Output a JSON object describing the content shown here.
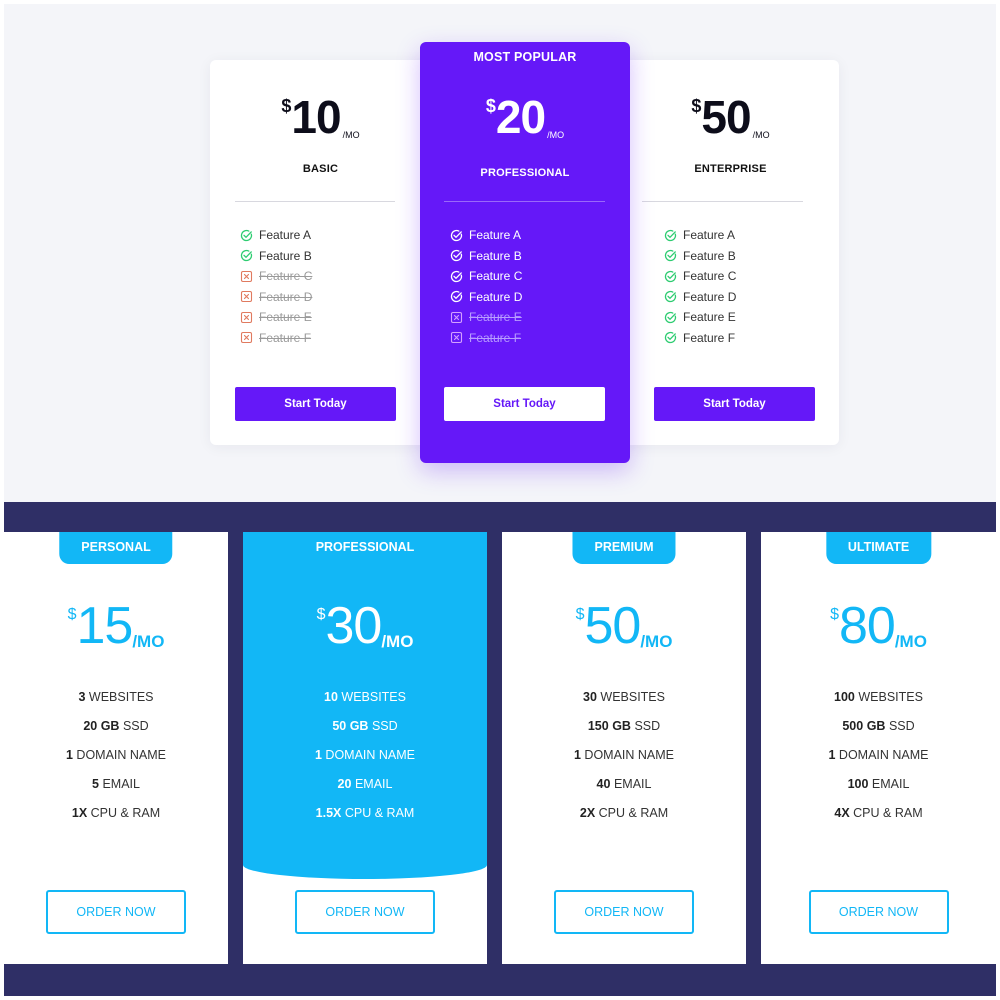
{
  "colors": {
    "purple_accent": "#6518f8",
    "sky_accent": "#12b7f6",
    "navy_band": "#2f2f66",
    "check_green": "#2ecc71",
    "cross_red": "#e07a5f"
  },
  "top_plans": [
    {
      "currency": "$",
      "amount": "10",
      "per": "/MO",
      "name": "BASIC",
      "features": [
        {
          "label": "Feature A",
          "included": true
        },
        {
          "label": "Feature B",
          "included": true
        },
        {
          "label": "Feature C",
          "included": false
        },
        {
          "label": "Feature D",
          "included": false
        },
        {
          "label": "Feature E",
          "included": false
        },
        {
          "label": "Feature F",
          "included": false
        }
      ],
      "button": "Start Today"
    },
    {
      "ribbon": "MOST POPULAR",
      "currency": "$",
      "amount": "20",
      "per": "/MO",
      "name": "PROFESSIONAL",
      "features": [
        {
          "label": "Feature A",
          "included": true
        },
        {
          "label": "Feature B",
          "included": true
        },
        {
          "label": "Feature C",
          "included": true
        },
        {
          "label": "Feature D",
          "included": true
        },
        {
          "label": "Feature E",
          "included": false
        },
        {
          "label": "Feature F",
          "included": false
        }
      ],
      "button": "Start Today"
    },
    {
      "currency": "$",
      "amount": "50",
      "per": "/MO",
      "name": "ENTERPRISE",
      "features": [
        {
          "label": "Feature A",
          "included": true
        },
        {
          "label": "Feature B",
          "included": true
        },
        {
          "label": "Feature C",
          "included": true
        },
        {
          "label": "Feature D",
          "included": true
        },
        {
          "label": "Feature E",
          "included": true
        },
        {
          "label": "Feature F",
          "included": true
        }
      ],
      "button": "Start Today"
    }
  ],
  "bottom_plans": [
    {
      "tag": "PERSONAL",
      "currency": "$",
      "amount": "15",
      "per": "/MO",
      "specs": [
        {
          "value": "3",
          "text": "WEBSITES"
        },
        {
          "value": "20 GB",
          "text": "SSD"
        },
        {
          "value": "1",
          "text": "DOMAIN NAME"
        },
        {
          "value": "5",
          "text": "EMAIL"
        },
        {
          "value": "1X",
          "text": "CPU & RAM"
        }
      ],
      "button": "ORDER NOW"
    },
    {
      "tag": "PROFESSIONAL",
      "currency": "$",
      "amount": "30",
      "per": "/MO",
      "specs": [
        {
          "value": "10",
          "text": "WEBSITES"
        },
        {
          "value": "50 GB",
          "text": "SSD"
        },
        {
          "value": "1",
          "text": "DOMAIN NAME"
        },
        {
          "value": "20",
          "text": "EMAIL"
        },
        {
          "value": "1.5X",
          "text": "CPU & RAM"
        }
      ],
      "button": "ORDER NOW"
    },
    {
      "tag": "PREMIUM",
      "currency": "$",
      "amount": "50",
      "per": "/MO",
      "specs": [
        {
          "value": "30",
          "text": "WEBSITES"
        },
        {
          "value": "150 GB",
          "text": "SSD"
        },
        {
          "value": "1",
          "text": "DOMAIN NAME"
        },
        {
          "value": "40",
          "text": "EMAIL"
        },
        {
          "value": "2X",
          "text": "CPU & RAM"
        }
      ],
      "button": "ORDER NOW"
    },
    {
      "tag": "ULTIMATE",
      "currency": "$",
      "amount": "80",
      "per": "/MO",
      "specs": [
        {
          "value": "100",
          "text": "WEBSITES"
        },
        {
          "value": "500 GB",
          "text": "SSD"
        },
        {
          "value": "1",
          "text": "DOMAIN NAME"
        },
        {
          "value": "100",
          "text": "EMAIL"
        },
        {
          "value": "4X",
          "text": "CPU & RAM"
        }
      ],
      "button": "ORDER NOW"
    }
  ]
}
